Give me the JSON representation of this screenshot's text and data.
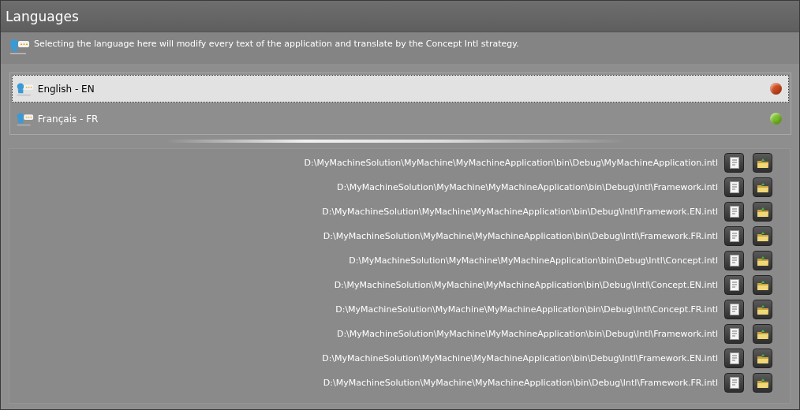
{
  "window": {
    "title": "Languages"
  },
  "description": "Selecting the language here will modify every text of the application and translate by the Concept Intl strategy.",
  "languages": [
    {
      "label": "English - EN",
      "selected": true,
      "color": "#d24a1c"
    },
    {
      "label": "Français - FR",
      "selected": false,
      "color": "#7cc22a"
    }
  ],
  "files": [
    "D:\\MyMachineSolution\\MyMachine\\MyMachineApplication\\bin\\Debug\\MyMachineApplication.intl",
    "D:\\MyMachineSolution\\MyMachine\\MyMachineApplication\\bin\\Debug\\Intl\\Framework.intl",
    "D:\\MyMachineSolution\\MyMachine\\MyMachineApplication\\bin\\Debug\\Intl\\Framework.EN.intl",
    "D:\\MyMachineSolution\\MyMachine\\MyMachineApplication\\bin\\Debug\\Intl\\Framework.FR.intl",
    "D:\\MyMachineSolution\\MyMachine\\MyMachineApplication\\bin\\Debug\\Intl\\Concept.intl",
    "D:\\MyMachineSolution\\MyMachine\\MyMachineApplication\\bin\\Debug\\Intl\\Concept.EN.intl",
    "D:\\MyMachineSolution\\MyMachine\\MyMachineApplication\\bin\\Debug\\Intl\\Concept.FR.intl",
    "D:\\MyMachineSolution\\MyMachine\\MyMachineApplication\\bin\\Debug\\Intl\\Framework.intl",
    "D:\\MyMachineSolution\\MyMachine\\MyMachineApplication\\bin\\Debug\\Intl\\Framework.EN.intl",
    "D:\\MyMachineSolution\\MyMachine\\MyMachineApplication\\bin\\Debug\\Intl\\Framework.FR.intl"
  ]
}
